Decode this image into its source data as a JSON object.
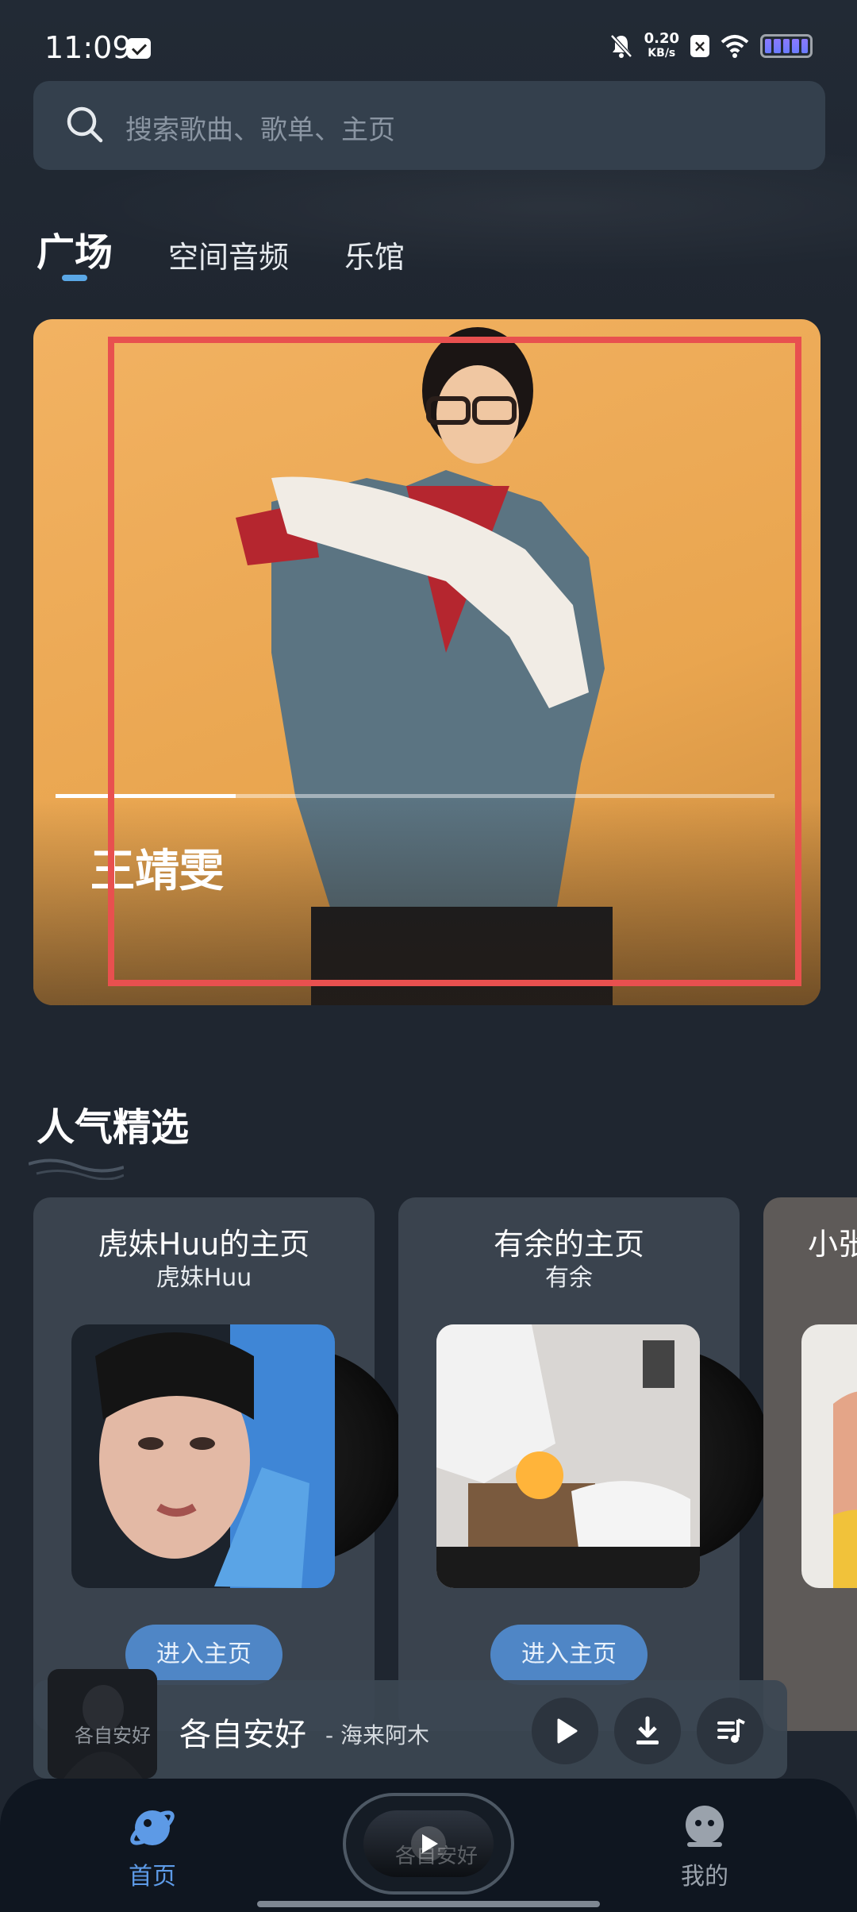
{
  "status_bar": {
    "time": "11:09",
    "network_speed_value": "0.20",
    "network_speed_unit": "KB/s"
  },
  "search": {
    "placeholder": "搜索歌曲、歌单、主页"
  },
  "tabs": [
    {
      "label": "广场",
      "active": true
    },
    {
      "label": "空间音频",
      "active": false
    },
    {
      "label": "乐馆",
      "active": false
    }
  ],
  "banner": {
    "title": "王靖雯",
    "progress": 0.25
  },
  "section": {
    "title": "人气精选"
  },
  "cards": [
    {
      "title": "虎妹Huu的主页",
      "subtitle": "虎妹Huu",
      "button": "进入主页"
    },
    {
      "title": "有余的主页",
      "subtitle": "有余",
      "button": "进入主页"
    },
    {
      "title": "小张",
      "subtitle": "",
      "button": ""
    }
  ],
  "mini_player": {
    "song": "各自安好",
    "artist": "- 海来阿木"
  },
  "bottom_nav": {
    "home_label": "首页",
    "mine_label": "我的"
  },
  "colors": {
    "accent": "#5aa7e6",
    "button": "#4f86c6",
    "highlight_box": "#e8504f"
  }
}
